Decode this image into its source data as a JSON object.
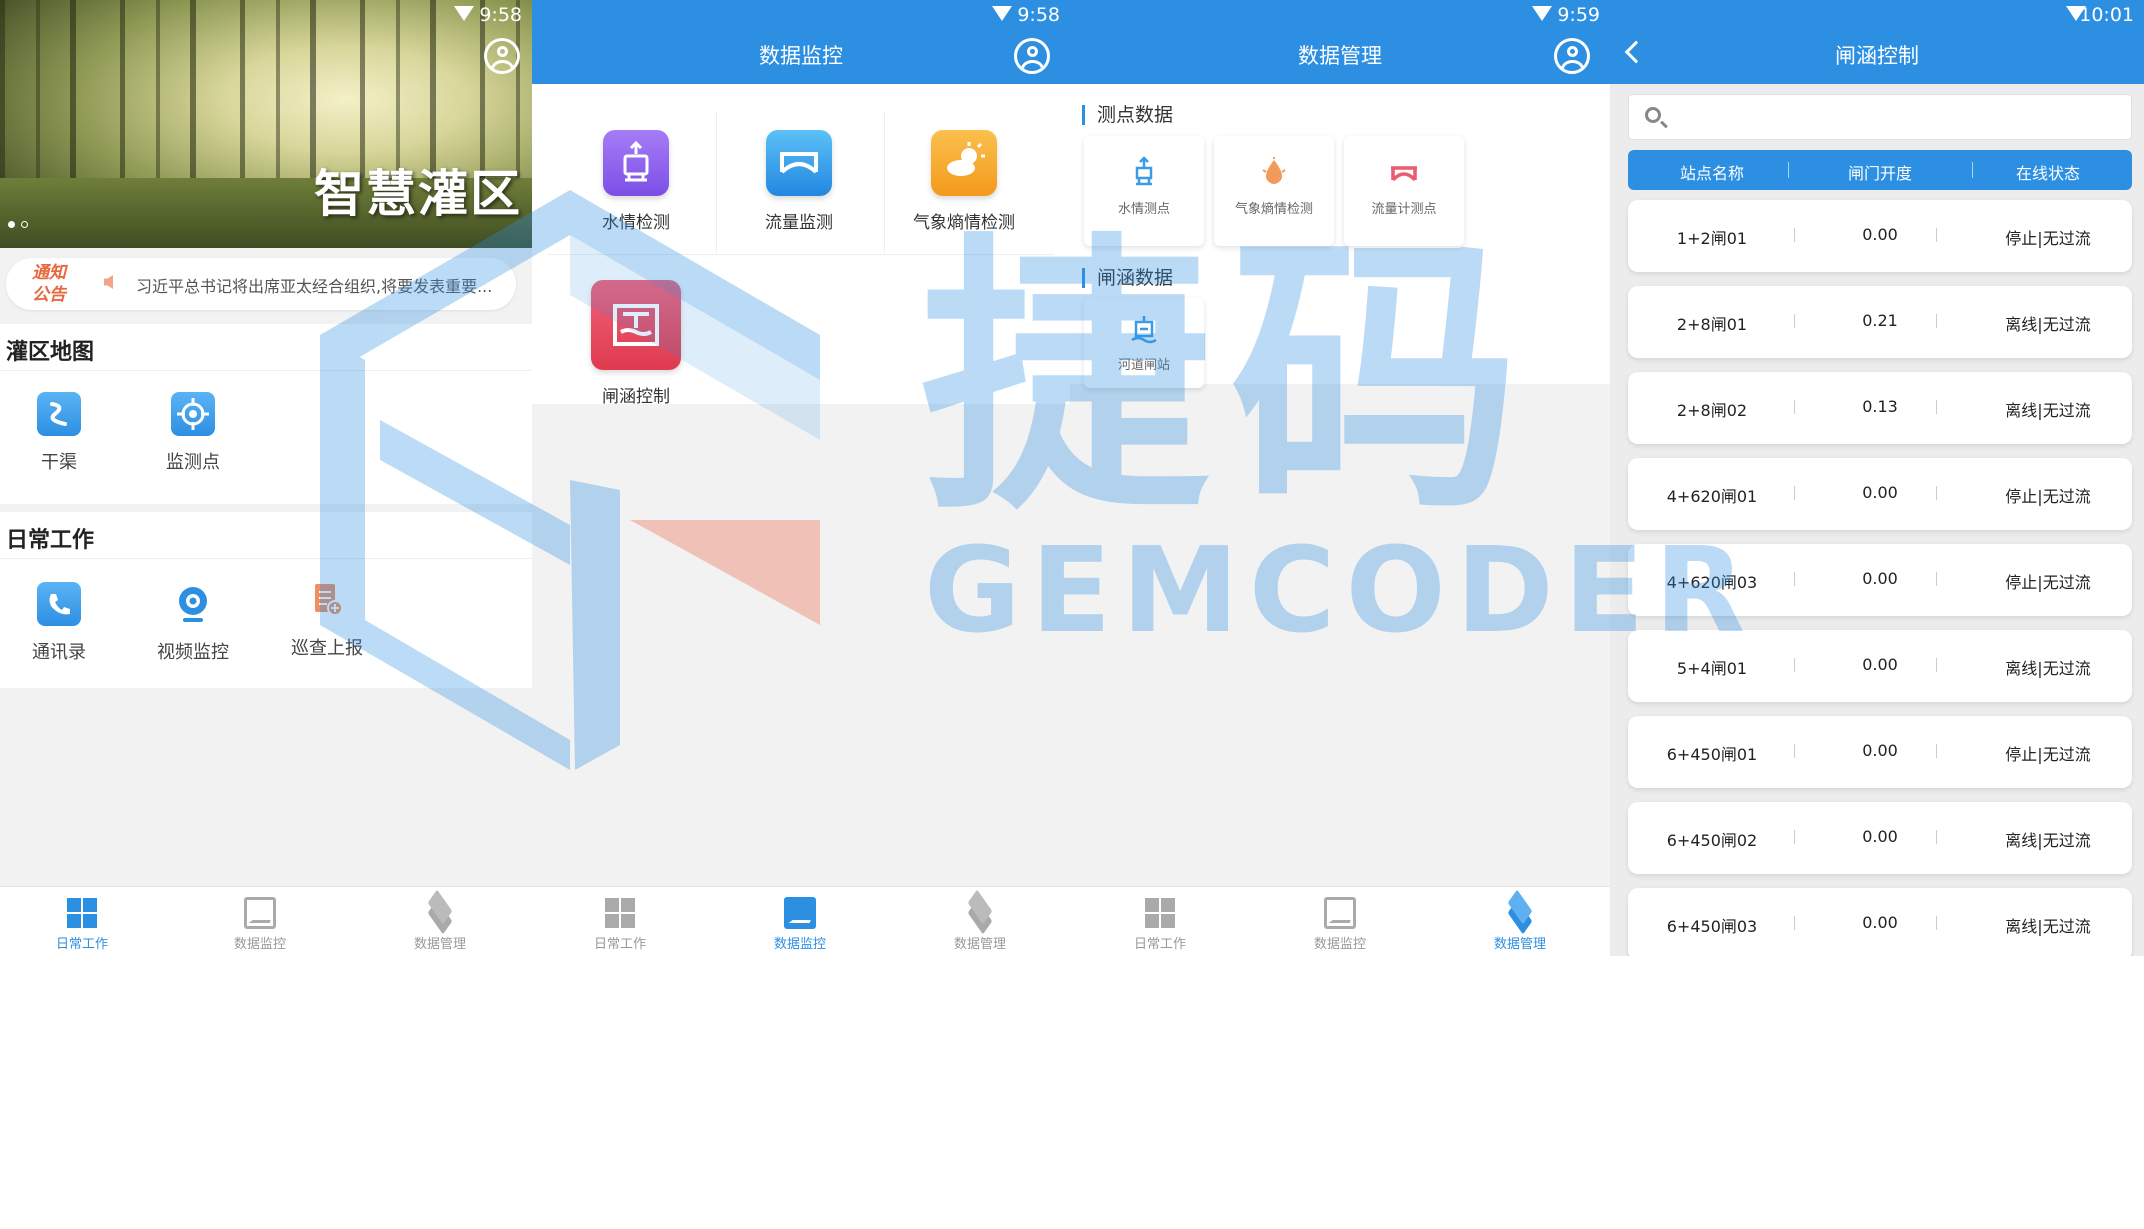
{
  "screen1": {
    "time": "9:58",
    "banner_title": "智慧灌区",
    "notice_badge_line1": "通知",
    "notice_badge_line2": "公告",
    "notice_text": "习近平总书记将出席亚太经合组织,将要发表重要...",
    "map_section": {
      "title": "灌区地图",
      "items": [
        {
          "label": "干渠",
          "icon": "canal-icon"
        },
        {
          "label": "监测点",
          "icon": "target-icon"
        }
      ]
    },
    "work_section": {
      "title": "日常工作",
      "items": [
        {
          "label": "通讯录",
          "icon": "contacts-icon"
        },
        {
          "label": "视频监控",
          "icon": "camera-icon"
        },
        {
          "label": "巡查上报",
          "icon": "report-icon"
        }
      ]
    }
  },
  "screen2": {
    "time": "9:58",
    "title": "数据监控",
    "items": [
      {
        "label": "水情检测",
        "icon": "water-level-icon",
        "color": "#8a5cf0"
      },
      {
        "label": "流量监测",
        "icon": "bridge-icon",
        "color": "#2f9ae8"
      },
      {
        "label": "气象熵情检测",
        "icon": "weather-icon",
        "color": "#f5a623"
      },
      {
        "label": "闸涵控制",
        "icon": "sluice-icon",
        "color": "#e8455a"
      }
    ]
  },
  "screen3": {
    "time": "9:59",
    "title": "数据管理",
    "section1": {
      "title": "测点数据",
      "items": [
        {
          "label": "水情测点",
          "icon": "water-level-icon"
        },
        {
          "label": "气象熵情检测",
          "icon": "drop-icon"
        },
        {
          "label": "流量计测点",
          "icon": "bridge-icon"
        }
      ]
    },
    "section2": {
      "title": "闸涵数据",
      "items": [
        {
          "label": "河道闸站",
          "icon": "gate-station-icon"
        }
      ]
    }
  },
  "screen4": {
    "time": "10:01",
    "title": "闸涵控制",
    "search_placeholder": "",
    "columns": [
      "站点名称",
      "闸门开度",
      "在线状态"
    ],
    "rows": [
      {
        "name": "1+2闸01",
        "open": "0.00",
        "status": "停止|无过流"
      },
      {
        "name": "2+8闸01",
        "open": "0.21",
        "status": "离线|无过流"
      },
      {
        "name": "2+8闸02",
        "open": "0.13",
        "status": "离线|无过流"
      },
      {
        "name": "4+620闸01",
        "open": "0.00",
        "status": "停止|无过流"
      },
      {
        "name": "4+620闸03",
        "open": "0.00",
        "status": "停止|无过流"
      },
      {
        "name": "5+4闸01",
        "open": "0.00",
        "status": "离线|无过流"
      },
      {
        "name": "6+450闸01",
        "open": "0.00",
        "status": "停止|无过流"
      },
      {
        "name": "6+450闸02",
        "open": "0.00",
        "status": "离线|无过流"
      },
      {
        "name": "6+450闸03",
        "open": "0.00",
        "status": "离线|无过流"
      }
    ]
  },
  "tabbar": [
    "日常工作",
    "数据监控",
    "数据管理"
  ],
  "watermark": {
    "cn": "捷码",
    "en": "GEMCODER"
  },
  "colors": {
    "primary": "#2d8fe2",
    "tab_inactive": "#999999",
    "notice": "#e8673d"
  }
}
